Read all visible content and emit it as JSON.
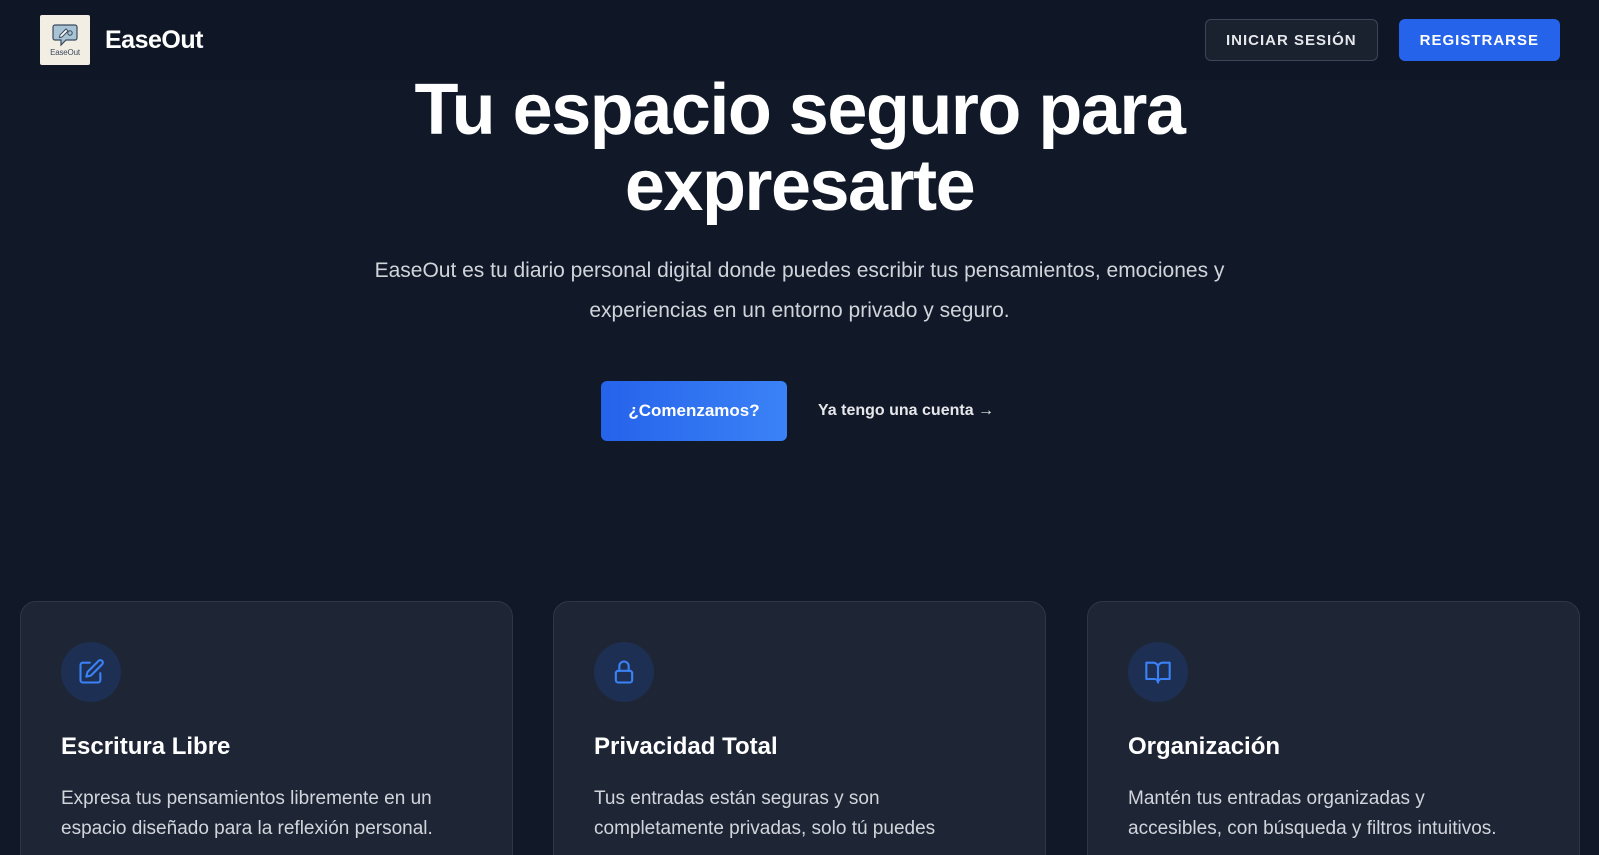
{
  "header": {
    "brand": "EaseOut",
    "logo_text": "EaseOut",
    "login_label": "INICIAR SESIÓN",
    "register_label": "REGISTRARSE"
  },
  "hero": {
    "title_line1": "Tu espacio seguro para",
    "title_line2": "expresarte",
    "subtitle_line1": "EaseOut es tu diario personal digital donde puedes escribir tus pensamientos, emociones y",
    "subtitle_line2": "experiencias en un entorno privado y seguro.",
    "cta_label": "¿Comenzamos?",
    "secondary_label": "Ya tengo una cuenta →"
  },
  "features": [
    {
      "icon": "pencil-square-icon",
      "title": "Escritura Libre",
      "line1": "Expresa tus pensamientos libremente en un",
      "line2": "espacio diseñado para la reflexión personal."
    },
    {
      "icon": "lock-icon",
      "title": "Privacidad Total",
      "line1": "Tus entradas están seguras y son",
      "line2": "completamente privadas, solo tú puedes"
    },
    {
      "icon": "book-open-icon",
      "title": "Organización",
      "line1": "Mantén tus entradas organizadas y",
      "line2": "accesibles, con búsqueda y filtros intuitivos."
    }
  ],
  "colors": {
    "background": "#111827",
    "navbar": "#0f1726",
    "accent": "#2563eb",
    "card": "#1e2636",
    "icon": "#3b82f6"
  }
}
